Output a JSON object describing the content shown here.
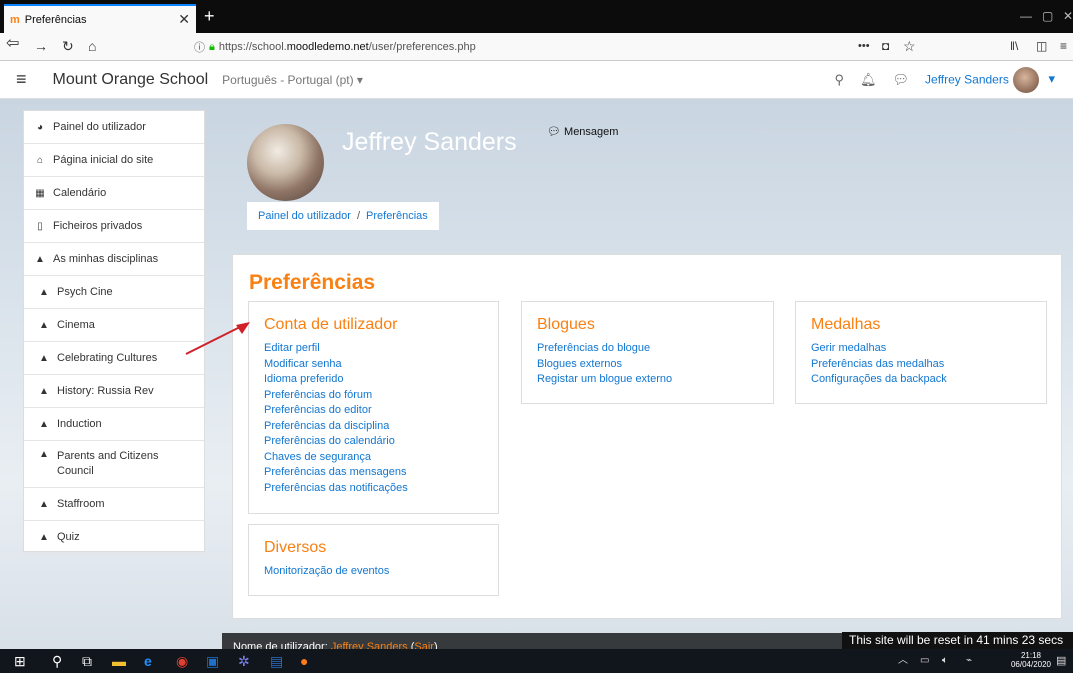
{
  "browser": {
    "tab_title": "Preferências",
    "tab_favicon": "moodle-icon",
    "url_prefix": "https://school.",
    "url_domain": "moodledemo.net",
    "url_path": "/user/preferences.php",
    "page_actions_label": "•••"
  },
  "header": {
    "site_name": "Mount Orange School",
    "language": "Português - Portugal (pt)",
    "user_name": "Jeffrey Sanders"
  },
  "drawer": {
    "items": [
      {
        "label": "Painel do utilizador",
        "icon": "dashboard-icon"
      },
      {
        "label": "Página inicial do site",
        "icon": "home-icon"
      },
      {
        "label": "Calendário",
        "icon": "calendar-icon"
      },
      {
        "label": "Ficheiros privados",
        "icon": "file-icon"
      },
      {
        "label": "As minhas disciplinas",
        "icon": "graduation-cap-icon"
      },
      {
        "label": "Psych Cine",
        "icon": "graduation-cap-icon"
      },
      {
        "label": "Cinema",
        "icon": "graduation-cap-icon"
      },
      {
        "label": "Celebrating Cultures",
        "icon": "graduation-cap-icon"
      },
      {
        "label": "History: Russia Rev",
        "icon": "graduation-cap-icon"
      },
      {
        "label": "Induction",
        "icon": "graduation-cap-icon"
      },
      {
        "label": "Parents and Citizens Council",
        "icon": "graduation-cap-icon"
      },
      {
        "label": "Staffroom",
        "icon": "graduation-cap-icon"
      },
      {
        "label": "Quiz",
        "icon": "graduation-cap-icon"
      }
    ]
  },
  "profile": {
    "full_name": "Jeffrey Sanders",
    "message_label": "Mensagem",
    "breadcrumb": [
      "Painel do utilizador",
      "Preferências"
    ]
  },
  "main": {
    "title": "Preferências",
    "sections": {
      "account": {
        "title": "Conta de utilizador",
        "links": [
          "Editar perfil",
          "Modificar senha",
          "Idioma preferido",
          "Preferências do fórum",
          "Preferências do editor",
          "Preferências da disciplina",
          "Preferências do calendário",
          "Chaves de segurança",
          "Preferências das mensagens",
          "Preferências das notificações"
        ]
      },
      "blogs": {
        "title": "Blogues",
        "links": [
          "Preferências do blogue",
          "Blogues externos",
          "Registar um blogue externo"
        ]
      },
      "badges": {
        "title": "Medalhas",
        "links": [
          "Gerir medalhas",
          "Preferências das medalhas",
          "Configurações da backpack"
        ]
      },
      "misc": {
        "title": "Diversos",
        "links": [
          "Monitorização de eventos"
        ]
      }
    }
  },
  "footer": {
    "prefix": "Nome de utilizador: ",
    "user": "Jeffrey Sanders",
    "logout": "Sair",
    "reset_notice": "This site will be reset in 41 mins 23 secs"
  },
  "taskbar": {
    "time": "21:18",
    "date": "06/04/2020"
  },
  "colors": {
    "accent": "#f98012",
    "link": "#1177d1",
    "annotation_arrow": "#d0202a"
  }
}
